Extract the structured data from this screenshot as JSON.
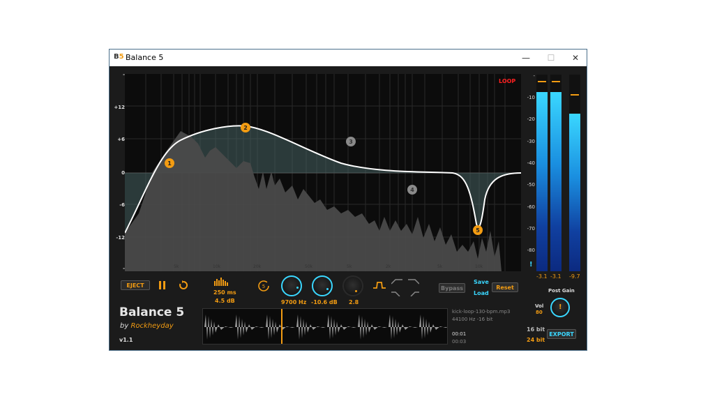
{
  "window": {
    "app_icon": "B",
    "app_icon_num": "5",
    "title": "Balance 5",
    "minimize": "—",
    "maximize": "☐",
    "close": "✕"
  },
  "eq": {
    "y_labels": [
      "-",
      "+12",
      "+6",
      "0",
      "-6",
      "-12",
      "-"
    ],
    "x_labels": [
      "5k",
      "10k",
      "20k",
      "50k",
      "5k",
      "2k",
      "5k",
      "10k"
    ],
    "loop_label": "LOOP",
    "bands": [
      "1",
      "2",
      "3",
      "4",
      "5"
    ]
  },
  "meters": {
    "scale": [
      "-",
      "-10",
      "-20",
      "-30",
      "-40",
      "-50",
      "-60",
      "-70",
      "-80"
    ],
    "levels": [
      0.91,
      0.91,
      0.8
    ],
    "values": [
      "-3.1",
      "-3.1",
      "-9.7"
    ],
    "warning": "!"
  },
  "transport": {
    "eject": "EJECT",
    "pause_icon": "pause-icon",
    "loop_icon": "loop-icon"
  },
  "params": {
    "window_ms": "250 ms",
    "gain_db": "4.5 dB",
    "freq": "9700 Hz",
    "gain": "-10.6 dB",
    "q": "2.8",
    "bypass": "Bypass",
    "save": "Save",
    "load": "Load",
    "reset": "Reset"
  },
  "brand": {
    "name": "Balance 5",
    "by": "by ",
    "author": "Rockheyday",
    "version": "v1.1"
  },
  "file": {
    "name": "kick-loop-130-bpm.mp3",
    "format": "44100 Hz -16 bit",
    "position": "00:01",
    "duration": "00:03"
  },
  "output": {
    "post_gain": "Post Gain",
    "vol_label": "Vol",
    "vol_value": "80",
    "bit16": "16 bit",
    "bit24": "24 bit",
    "export": "EXPORT",
    "knob_mark": "!"
  },
  "colors": {
    "accent": "#f39c12",
    "cyan": "#3ad7ff",
    "loop": "#ff2020"
  }
}
